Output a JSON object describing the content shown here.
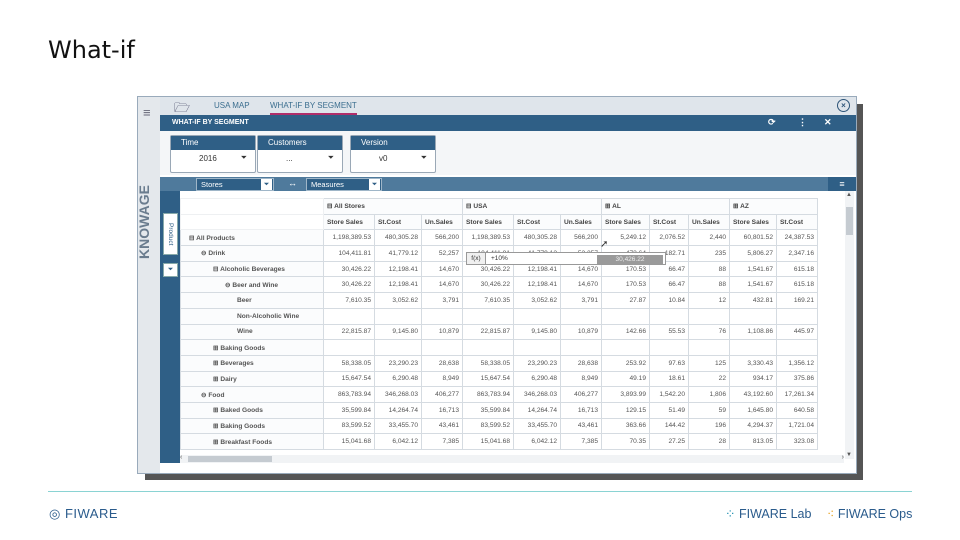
{
  "slide": {
    "title": "What-if"
  },
  "app": {
    "brand": "KNOWAGE",
    "tabs": [
      "USA MAP",
      "WHAT-IF BY SEGMENT"
    ],
    "document_title": "WHAT-IF BY SEGMENT"
  },
  "filters": [
    {
      "label": "Time",
      "value": "2016"
    },
    {
      "label": "Customers",
      "value": "..."
    },
    {
      "label": "Version",
      "value": "v0"
    }
  ],
  "axis": {
    "columns_dimension": "Stores",
    "measures_label": "Measures",
    "rows_dimension": "Product"
  },
  "pivot": {
    "column_groups": [
      {
        "label": "⊟ All Stores",
        "measures": [
          "Store Sales",
          "St.Cost",
          "Un.Sales"
        ]
      },
      {
        "label": "⊟ USA",
        "measures": [
          "Store Sales",
          "St.Cost",
          "Un.Sales"
        ]
      },
      {
        "label": "⊞ AL",
        "measures": [
          "Store Sales",
          "St.Cost",
          "Un.Sales"
        ]
      },
      {
        "label": "⊞ AZ",
        "measures": [
          "Store Sales",
          "St.Cost"
        ]
      }
    ],
    "rows": [
      {
        "label": "⊟ All Products",
        "indent": 0,
        "values": [
          "1,198,389.53",
          "480,305.28",
          "566,200",
          "1,198,389.53",
          "480,305.28",
          "566,200",
          "5,249.12",
          "2,076.52",
          "2,440",
          "60,801.52",
          "24,387.53"
        ]
      },
      {
        "label": "⊖ Drink",
        "indent": 1,
        "values": [
          "104,411.81",
          "41,779.12",
          "52,257",
          "104,411.81",
          "41,779.12",
          "52,257",
          "473.64",
          "182.71",
          "235",
          "5,806.27",
          "2,347.16"
        ]
      },
      {
        "label": "⊟ Alcoholic Beverages",
        "indent": 2,
        "values": [
          "30,426.22",
          "12,198.41",
          "14,670",
          "30,426.22",
          "12,198.41",
          "14,670",
          "170.53",
          "66.47",
          "88",
          "1,541.67",
          "615.18"
        ]
      },
      {
        "label": "⊖ Beer and Wine",
        "indent": 3,
        "values": [
          "30,426.22",
          "12,198.41",
          "14,670",
          "30,426.22",
          "12,198.41",
          "14,670",
          "170.53",
          "66.47",
          "88",
          "1,541.67",
          "615.18"
        ]
      },
      {
        "label": "Beer",
        "indent": 4,
        "values": [
          "7,610.35",
          "3,052.62",
          "3,791",
          "7,610.35",
          "3,052.62",
          "3,791",
          "27.87",
          "10.84",
          "12",
          "432.81",
          "169.21"
        ]
      },
      {
        "label": "Non-Alcoholic Wine",
        "indent": 4,
        "values": [
          "",
          "",
          "",
          "",
          "",
          "",
          "",
          "",
          "",
          "",
          ""
        ]
      },
      {
        "label": "Wine",
        "indent": 4,
        "values": [
          "22,815.87",
          "9,145.80",
          "10,879",
          "22,815.87",
          "9,145.80",
          "10,879",
          "142.66",
          "55.53",
          "76",
          "1,108.86",
          "445.97"
        ]
      },
      {
        "label": "⊞ Baking Goods",
        "indent": 2,
        "values": [
          "",
          "",
          "",
          "",
          "",
          "",
          "",
          "",
          "",
          "",
          ""
        ]
      },
      {
        "label": "⊞ Beverages",
        "indent": 2,
        "values": [
          "58,338.05",
          "23,290.23",
          "28,638",
          "58,338.05",
          "23,290.23",
          "28,638",
          "253.92",
          "97.63",
          "125",
          "3,330.43",
          "1,356.12"
        ]
      },
      {
        "label": "⊞ Dairy",
        "indent": 2,
        "values": [
          "15,647.54",
          "6,290.48",
          "8,949",
          "15,647.54",
          "6,290.48",
          "8,949",
          "49.19",
          "18.61",
          "22",
          "934.17",
          "375.86"
        ]
      },
      {
        "label": "⊖ Food",
        "indent": 1,
        "values": [
          "863,783.94",
          "346,268.03",
          "406,277",
          "863,783.94",
          "346,268.03",
          "406,277",
          "3,893.99",
          "1,542.20",
          "1,806",
          "43,192.60",
          "17,261.34"
        ]
      },
      {
        "label": "⊞ Baked Goods",
        "indent": 2,
        "values": [
          "35,599.84",
          "14,264.74",
          "16,713",
          "35,599.84",
          "14,264.74",
          "16,713",
          "129.15",
          "51.49",
          "59",
          "1,645.80",
          "640.58"
        ]
      },
      {
        "label": "⊞ Baking Goods",
        "indent": 2,
        "values": [
          "83,599.52",
          "33,455.70",
          "43,461",
          "83,599.52",
          "33,455.70",
          "43,461",
          "363.66",
          "144.42",
          "196",
          "4,294.37",
          "1,721.04"
        ]
      },
      {
        "label": "⊞ Breakfast Foods",
        "indent": 2,
        "values": [
          "15,041.68",
          "6,042.12",
          "7,385",
          "15,041.68",
          "6,042.12",
          "7,385",
          "70.35",
          "27.25",
          "28",
          "813.05",
          "323.08"
        ]
      }
    ]
  },
  "editor": {
    "fx_label": "f(x)",
    "input_value": "+10%",
    "suggestion": "30,426.22"
  },
  "footer": {
    "left_logo": "FIWARE",
    "lab_logo": "FIWARE Lab",
    "ops_logo": "FIWARE Ops"
  },
  "colors": {
    "header_blue": "#2f5f86",
    "accent_pink": "#b02d6a",
    "brand_orange": "#e8a320",
    "footer_line": "#8ad3d3"
  }
}
